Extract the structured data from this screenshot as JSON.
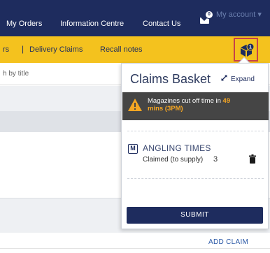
{
  "topnav": {
    "items": [
      "My Orders",
      "Information Centre",
      "Contact Us"
    ],
    "notification_count": "0",
    "account_label": "My account",
    "account_caret": "▾"
  },
  "subnav": {
    "items": [
      "rs",
      "Delivery Claims",
      "Recall notes"
    ],
    "separator": "|",
    "basket_count": "1"
  },
  "page": {
    "search_placeholder": "h by title",
    "add_claim_label": "ADD CLAIM"
  },
  "basket": {
    "title": "Claims Basket",
    "expand_label": "Expand",
    "cutoff_prefix": "Magazines cut off time in",
    "cutoff_minutes": "49",
    "cutoff_unit": "mins (3PM)",
    "item": {
      "badge": "M",
      "title": "ANGLING TIMES",
      "status": "Claimed (to supply)",
      "quantity": "3"
    },
    "submit_label": "SUBMIT"
  },
  "colors": {
    "navy": "#1e2c5e",
    "yellow": "#f4c21e",
    "warning_orange": "#f5a623",
    "highlight_red": "#c64149"
  }
}
